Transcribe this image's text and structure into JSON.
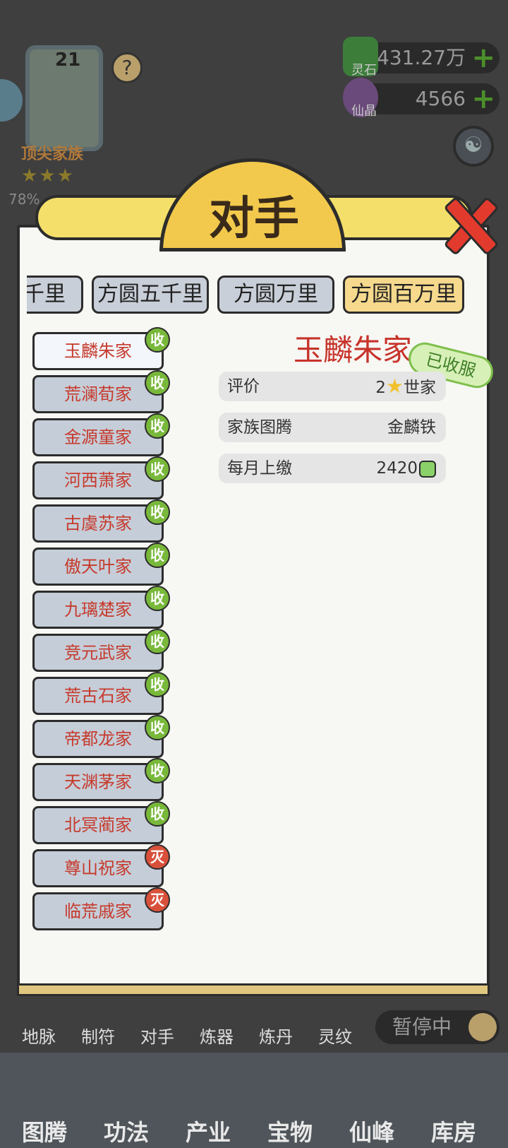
{
  "hud": {
    "level": "21",
    "clan_label": "顶尖家族",
    "stars": "★★★",
    "percent": "78%",
    "spirit_stone": {
      "label": "灵石",
      "value": "1431.27万"
    },
    "immortal_crystal": {
      "label": "仙晶",
      "value": "4566"
    }
  },
  "modal": {
    "title": "对手",
    "tabs": [
      "千里",
      "方圆五千里",
      "方圆万里",
      "方圆百万里"
    ],
    "active_tab": 3,
    "families": [
      {
        "name": "玉麟朱家",
        "badge": "收",
        "badge_color": "green",
        "selected": true
      },
      {
        "name": "荒澜荀家",
        "badge": "收",
        "badge_color": "green"
      },
      {
        "name": "金源童家",
        "badge": "收",
        "badge_color": "green"
      },
      {
        "name": "河西萧家",
        "badge": "收",
        "badge_color": "green"
      },
      {
        "name": "古虞苏家",
        "badge": "收",
        "badge_color": "green"
      },
      {
        "name": "傲天叶家",
        "badge": "收",
        "badge_color": "green"
      },
      {
        "name": "九璃楚家",
        "badge": "收",
        "badge_color": "green"
      },
      {
        "name": "竞元武家",
        "badge": "收",
        "badge_color": "green"
      },
      {
        "name": "荒古石家",
        "badge": "收",
        "badge_color": "green"
      },
      {
        "name": "帝都龙家",
        "badge": "收",
        "badge_color": "green"
      },
      {
        "name": "天渊茅家",
        "badge": "收",
        "badge_color": "green"
      },
      {
        "name": "北冥蔺家",
        "badge": "收",
        "badge_color": "green"
      },
      {
        "name": "尊山祝家",
        "badge": "灭",
        "badge_color": "red"
      },
      {
        "name": "临荒戚家",
        "badge": "灭",
        "badge_color": "red"
      }
    ],
    "detail": {
      "name": "玉麟朱家",
      "status_stamp": "已收服",
      "rating_label": "评价",
      "rating_value_num": "2",
      "rating_value_text": "世家",
      "totem_label": "家族图腾",
      "totem_value": "金麟铁",
      "tribute_label": "每月上缴",
      "tribute_value": "2420"
    }
  },
  "actions": [
    "地脉",
    "制符",
    "对手",
    "炼器",
    "炼丹",
    "灵纹"
  ],
  "pause_label": "暂停中",
  "nav": [
    "图腾",
    "功法",
    "产业",
    "宝物",
    "仙峰",
    "库房"
  ],
  "colors": {
    "accent_red": "#c7332a",
    "badge_green": "#78b83a",
    "badge_red": "#d9503a",
    "tab_active": "#f6d98d"
  }
}
